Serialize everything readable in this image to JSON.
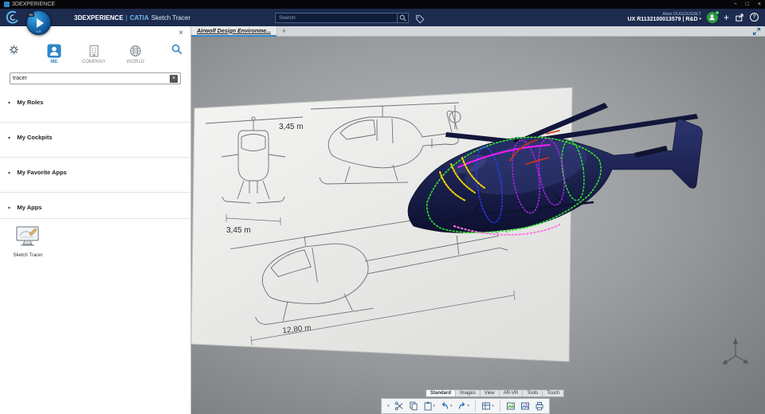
{
  "window": {
    "title": "3DEXPERIENCE",
    "minimize": "−",
    "maximize": "□",
    "close": "×"
  },
  "app_bar": {
    "brand": "3DEXPERIENCE",
    "separator": "|",
    "product": "CATIA",
    "module": "Sketch Tracer",
    "search_placeholder": "Search",
    "user_name": "Alain DUGOUSSET",
    "workspace": "UX R1132100013579 | R&D",
    "caret": "▾",
    "plus": "+",
    "help": "?",
    "compass": {
      "badge": "3D",
      "caption": "V.R"
    }
  },
  "tab_bar": {
    "active_tab": "Airwolf Design Environme...",
    "new_tab": "+"
  },
  "panel": {
    "close": "×",
    "clear": "×",
    "section_caret": "▾",
    "tabs": [
      {
        "label": "ME"
      },
      {
        "label": "COMPANY"
      },
      {
        "label": "WORLD"
      }
    ],
    "search_value": "tracer",
    "sections": [
      {
        "label": "My Roles"
      },
      {
        "label": "My Cockpits"
      },
      {
        "label": "My Favorite Apps"
      },
      {
        "label": "My Apps"
      }
    ],
    "app_label": "Sketch Tracer"
  },
  "viewport": {
    "dim_front": "3,45 m",
    "dim_side": "3,45 m",
    "dim_length": "12,80 m"
  },
  "bottom_bar": {
    "caret": "▾",
    "tabs": [
      {
        "label": "Standard"
      },
      {
        "label": "Images"
      },
      {
        "label": "View"
      },
      {
        "label": "AR-VR"
      },
      {
        "label": "Tools"
      },
      {
        "label": "Touch"
      }
    ]
  },
  "colors": {
    "appbar_bg": "#1c2b4e",
    "accent_blue": "#2e86c8",
    "heli_body": "#161b3e",
    "trace_green": "#30e830",
    "trace_magenta": "#ff1aff",
    "trace_yellow": "#ffd800",
    "trace_purple": "#b024f0",
    "trace_blue": "#2a3cff",
    "trace_pink": "#ff7ae0"
  }
}
